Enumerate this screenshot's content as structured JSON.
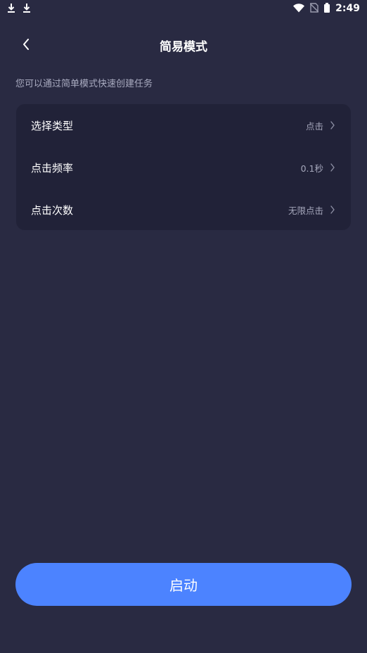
{
  "status_bar": {
    "time": "2:49",
    "left_icons": [
      "download-icon",
      "download-icon"
    ],
    "right_icons": [
      "wifi-icon",
      "no-sim-icon",
      "battery-icon"
    ]
  },
  "header": {
    "title": "简易模式",
    "back_icon": "chevron-left-icon"
  },
  "hint_text": "您可以通过简单模式快速创建任务",
  "settings": {
    "items": [
      {
        "label": "选择类型",
        "value": "点击"
      },
      {
        "label": "点击频率",
        "value": "0.1秒"
      },
      {
        "label": "点击次数",
        "value": "无限点击"
      }
    ]
  },
  "start_button": {
    "label": "启动"
  },
  "colors": {
    "background": "#292a42",
    "card": "#212238",
    "accent": "#4c83ff",
    "secondary_text": "#a5a7bb"
  }
}
